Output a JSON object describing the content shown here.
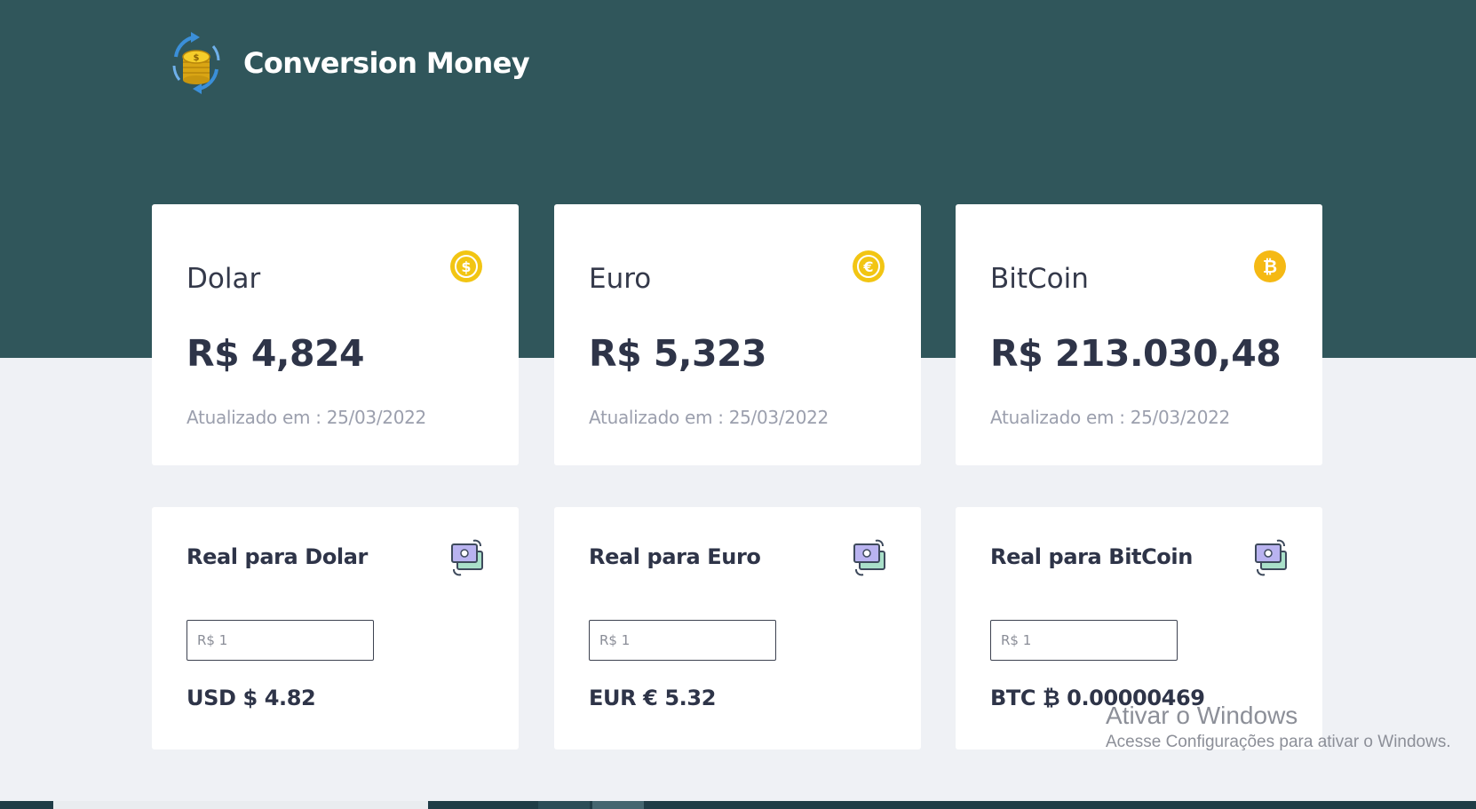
{
  "header": {
    "title": "Conversion Money",
    "logo_icon": "currency-exchange-coins-icon"
  },
  "rates": [
    {
      "name": "Dolar",
      "value": "R$ 4,824",
      "updated": "Atualizado em : 25/03/2022",
      "icon": "dollar-coin-icon"
    },
    {
      "name": "Euro",
      "value": "R$ 5,323",
      "updated": "Atualizado em : 25/03/2022",
      "icon": "euro-coin-icon"
    },
    {
      "name": "BitCoin",
      "value": "R$ 213.030,48",
      "updated": "Atualizado em : 25/03/2022",
      "icon": "bitcoin-coin-icon"
    }
  ],
  "converters": [
    {
      "title": "Real para Dolar",
      "input_placeholder": "R$ 1",
      "result": "USD $ 4.82",
      "icon": "money-swap-icon"
    },
    {
      "title": "Real para Euro",
      "input_placeholder": "R$ 1",
      "result": "EUR € 5.32",
      "icon": "money-swap-icon"
    },
    {
      "title": "Real para BitCoin",
      "input_placeholder": "R$ 1",
      "result": "BTC ₿ 0.00000469",
      "icon": "money-swap-icon"
    }
  ],
  "watermark": {
    "title": "Ativar o Windows",
    "subtitle": "Acesse Configurações para ativar o Windows."
  },
  "colors": {
    "hero_background": "#30565b",
    "page_background": "#eff1f5",
    "coin_gold": "#f2c513",
    "text_dark": "#2e3448",
    "text_muted": "#9b9fad"
  }
}
